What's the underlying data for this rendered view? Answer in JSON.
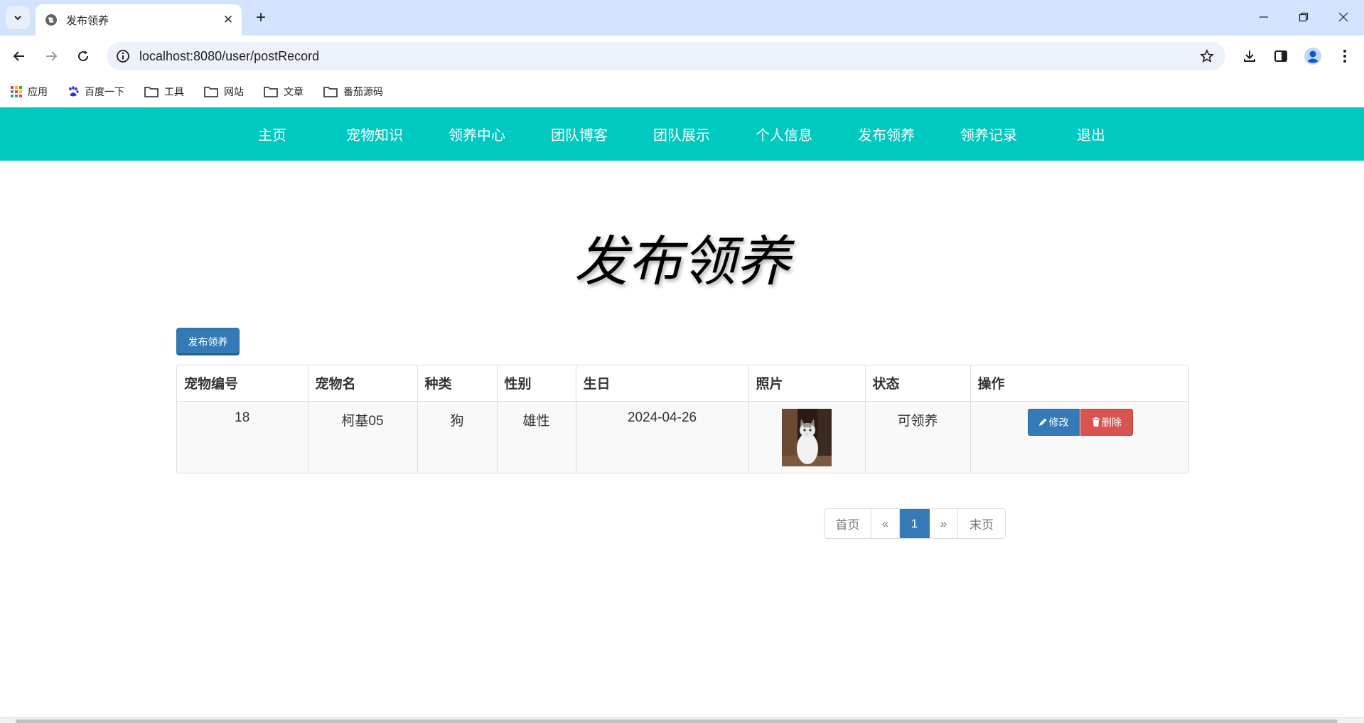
{
  "browser": {
    "tab_title": "发布领养",
    "url": "localhost:8080/user/postRecord",
    "bookmarks": [
      {
        "label": "应用",
        "icon": "apps-grid-icon"
      },
      {
        "label": "百度一下",
        "icon": "baidu-paw-icon"
      },
      {
        "label": "工具",
        "icon": "folder-icon"
      },
      {
        "label": "网站",
        "icon": "folder-icon"
      },
      {
        "label": "文章",
        "icon": "folder-icon"
      },
      {
        "label": "番茄源码",
        "icon": "folder-icon"
      }
    ]
  },
  "nav": {
    "items": [
      "主页",
      "宠物知识",
      "领养中心",
      "团队博客",
      "团队展示",
      "个人信息",
      "发布领养",
      "领养记录",
      "退出"
    ]
  },
  "page": {
    "heading": "发布领养",
    "publish_button": "发布领养"
  },
  "table": {
    "headers": [
      "宠物编号",
      "宠物名",
      "种类",
      "性别",
      "生日",
      "照片",
      "状态",
      "操作"
    ],
    "rows": [
      {
        "id": "18",
        "name": "柯基05",
        "species": "狗",
        "gender": "雄性",
        "birthday": "2024-04-26",
        "photo": "white-cat-photo",
        "status": "可领养",
        "edit_label": "修改",
        "delete_label": "删除"
      }
    ]
  },
  "pagination": {
    "first": "首页",
    "prev": "«",
    "current": "1",
    "next": "»",
    "last": "末页"
  },
  "colors": {
    "nav_bg": "#00c9c0",
    "primary": "#337ab7",
    "danger": "#d9534f",
    "tabbar_bg": "#d3e3fd"
  }
}
